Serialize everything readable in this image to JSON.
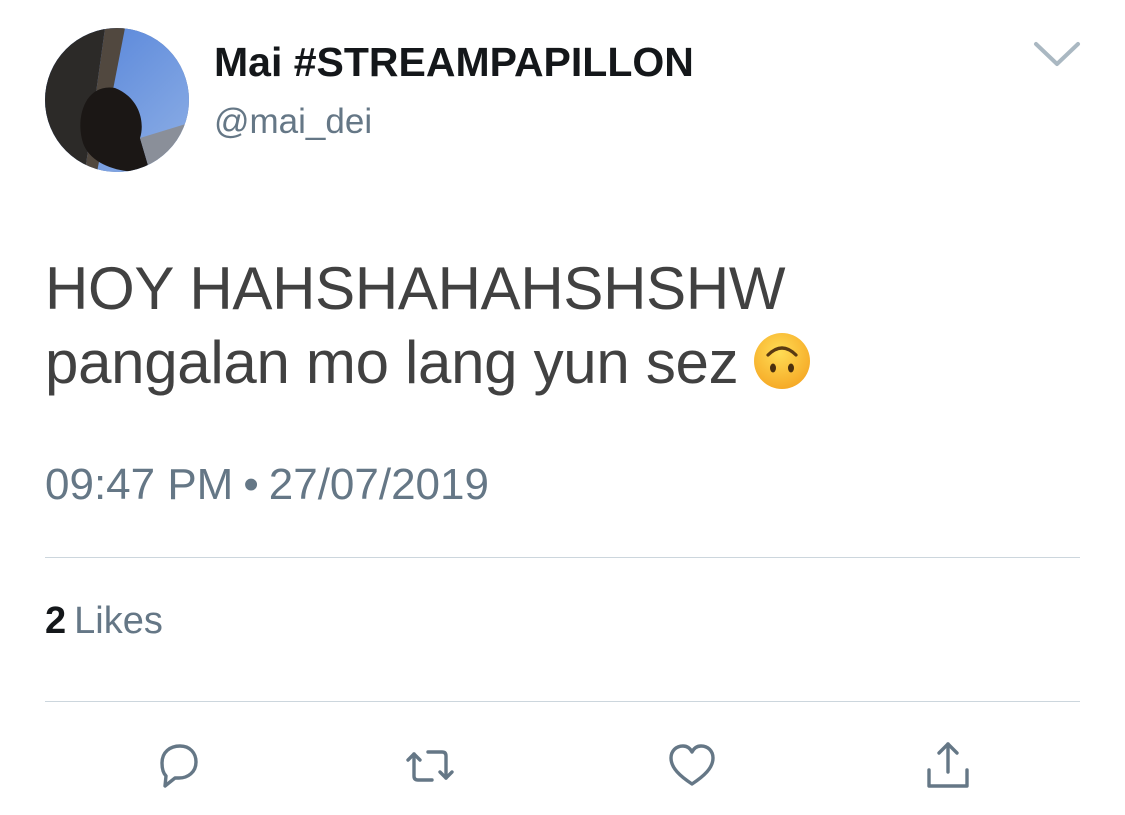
{
  "tweet": {
    "author": {
      "display_name": "Mai #STREAMPAPILLON",
      "handle": "@mai_dei",
      "avatar_icon": "profile-photo"
    },
    "text_lines": [
      "HOY HAHSHAHAHSHSHW",
      "pangalan mo lang yun sez"
    ],
    "emoji": "upside-down-face",
    "time": "09:47 PM",
    "separator": "•",
    "date": "27/07/2019",
    "likes": {
      "count": "2",
      "label": "Likes"
    }
  },
  "actions": {
    "menu_icon": "chevron-down-icon",
    "reply_icon": "reply-icon",
    "retweet_icon": "retweet-icon",
    "like_icon": "heart-icon",
    "share_icon": "share-icon"
  },
  "colors": {
    "text_primary": "#14171a",
    "text_secondary": "#657786",
    "tweet_body": "#414141",
    "divider": "#ccd6dd",
    "icon": "#657786"
  }
}
